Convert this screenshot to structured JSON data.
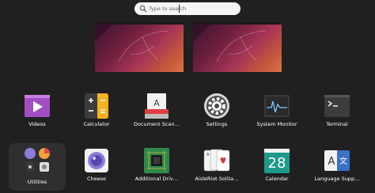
{
  "search": {
    "placeholder": "Type to search"
  },
  "apps": [
    {
      "label": "Videos",
      "icon": "videos-icon"
    },
    {
      "label": "Calculator",
      "icon": "calculator-icon"
    },
    {
      "label": "Document Scan…",
      "icon": "document-scanner-icon"
    },
    {
      "label": "Settings",
      "icon": "settings-icon"
    },
    {
      "label": "System Monitor",
      "icon": "system-monitor-icon"
    },
    {
      "label": "Terminal",
      "icon": "terminal-icon"
    },
    {
      "label": "Utilities",
      "icon": "utilities-folder-icon"
    },
    {
      "label": "Cheese",
      "icon": "cheese-icon"
    },
    {
      "label": "Additional Driv…",
      "icon": "additional-drivers-icon"
    },
    {
      "label": "AisleRiot Solita…",
      "icon": "aisleriot-icon"
    },
    {
      "label": "Calendar",
      "icon": "calendar-icon"
    },
    {
      "label": "Language Supp…",
      "icon": "language-support-icon"
    }
  ],
  "calendar": {
    "day": "28"
  },
  "colors": {
    "background": "#202020",
    "selected": "#2f2f2f",
    "accent": "#e95420"
  }
}
